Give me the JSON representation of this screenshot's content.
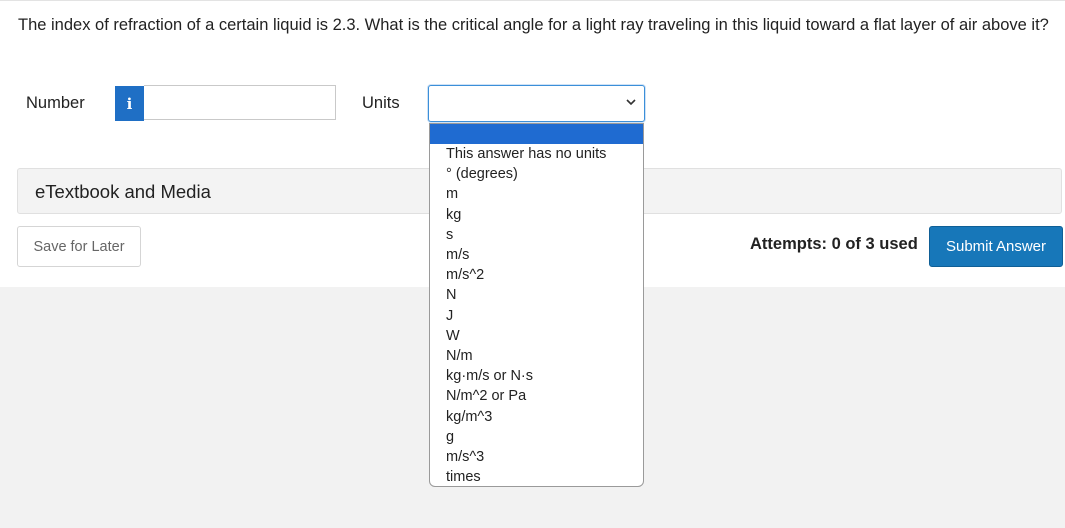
{
  "question": {
    "text": "The index of refraction of a certain liquid is 2.3. What is the critical angle for a light ray traveling in this liquid toward a flat layer of air above it?"
  },
  "answer": {
    "number_label": "Number",
    "info_icon_glyph": "i",
    "number_value": "",
    "units_label": "Units",
    "units_selected": "",
    "units_options": [
      "This answer has no units",
      "° (degrees)",
      "m",
      "kg",
      "s",
      "m/s",
      "m/s^2",
      "N",
      "J",
      "W",
      "N/m",
      "kg·m/s or N·s",
      "N/m^2 or Pa",
      "kg/m^3",
      "g",
      "m/s^3",
      "times"
    ]
  },
  "etextbook": {
    "label": "eTextbook and Media"
  },
  "footer": {
    "save_label": "Save for Later",
    "attempts_text": "Attempts: 0 of 3 used",
    "submit_label": "Submit Answer"
  },
  "colors": {
    "primary_blue": "#1777b9",
    "info_blue": "#1f6fc5",
    "dropdown_highlight": "#1f6bd1"
  }
}
